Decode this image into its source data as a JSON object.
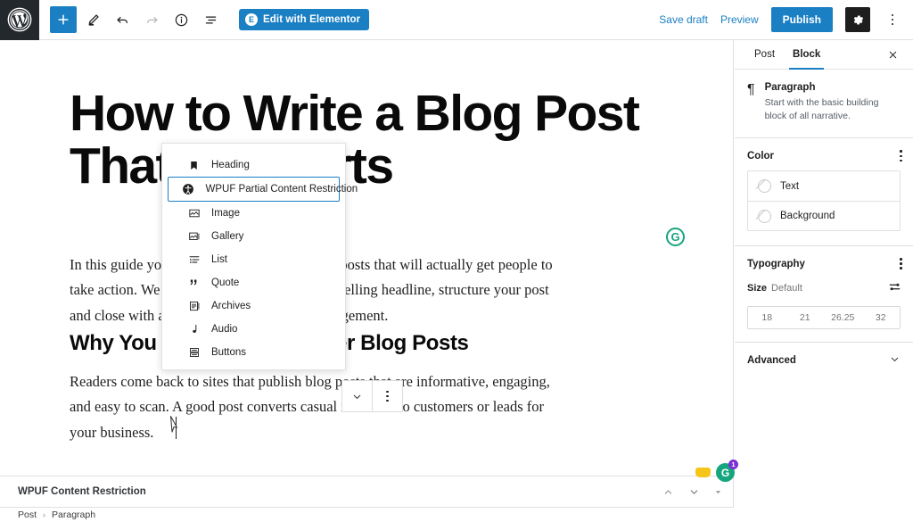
{
  "toolbar": {
    "logo_icon": "wordpress-logo-icon",
    "add_block_label": "+",
    "tools": [
      {
        "name": "add-block-button",
        "icon": "plus-icon"
      },
      {
        "name": "edit-tool-button",
        "icon": "pencil-icon"
      },
      {
        "name": "undo-button",
        "icon": "undo-icon"
      },
      {
        "name": "redo-button",
        "icon": "redo-icon"
      },
      {
        "name": "details-button",
        "icon": "info-icon"
      },
      {
        "name": "list-view-button",
        "icon": "list-view-icon"
      }
    ],
    "elementor_label": "Edit with Elementor",
    "elementor_badge": "E",
    "save_draft_label": "Save draft",
    "preview_label": "Preview",
    "publish_label": "Publish",
    "settings_icon": "gear-icon",
    "options_icon": "kebab-menu-icon",
    "accent_color": "#1b7fc4"
  },
  "editor": {
    "post_title": "How to Write a Blog Post That Converts",
    "paragraph_1": "In this guide you will learn how to write blog posts that will actually get people to take action. We will cover how to craft a compelling headline, structure your post and close with a call to action that drives engagement.",
    "heading_2": "Why You Should Write Better Blog Posts",
    "paragraph_2": "Readers come back to sites that publish blog posts that are informative, engaging, and easy to scan. A good post converts casual readers into customers or leads for your business.",
    "grammarly_icon": "grammarly-icon",
    "grammarly_letter": "G"
  },
  "inserter": {
    "items": [
      {
        "label": "Heading",
        "icon": "heading-icon",
        "selected": false
      },
      {
        "label": "WPUF Partial Content Restriction",
        "icon": "accessibility-icon",
        "selected": true
      },
      {
        "label": "Image",
        "icon": "image-icon",
        "selected": false
      },
      {
        "label": "Gallery",
        "icon": "gallery-icon",
        "selected": false
      },
      {
        "label": "List",
        "icon": "list-icon",
        "selected": false
      },
      {
        "label": "Quote",
        "icon": "quote-icon",
        "selected": false
      },
      {
        "label": "Archives",
        "icon": "archives-icon",
        "selected": false
      },
      {
        "label": "Audio",
        "icon": "audio-icon",
        "selected": false
      },
      {
        "label": "Buttons",
        "icon": "buttons-icon",
        "selected": false
      }
    ],
    "highlight_color": "#1b7fc4"
  },
  "sidebar": {
    "tabs": [
      {
        "label": "Post",
        "active": false
      },
      {
        "label": "Block",
        "active": true
      }
    ],
    "close_icon": "close-icon",
    "block": {
      "icon": "paragraph-icon",
      "glyph": "¶",
      "title": "Paragraph",
      "description": "Start with the basic building block of all narrative."
    },
    "color": {
      "title": "Color",
      "options_icon": "kebab-menu-icon",
      "rows": [
        {
          "label": "Text",
          "swatch": "none"
        },
        {
          "label": "Background",
          "swatch": "none"
        }
      ]
    },
    "typography": {
      "title": "Typography",
      "options_icon": "kebab-menu-icon",
      "size_label": "Size",
      "size_value": "Default",
      "adjust_icon": "sliders-icon",
      "sizes": [
        "18",
        "21",
        "26.25",
        "32"
      ]
    },
    "advanced": {
      "title": "Advanced",
      "chevron_icon": "chevron-down-icon"
    }
  },
  "bottom_panel": {
    "title": "WPUF Content Restriction",
    "actions": [
      {
        "name": "move-up-button",
        "icon": "chevron-up-icon"
      },
      {
        "name": "move-down-button",
        "icon": "chevron-down-icon"
      },
      {
        "name": "toggle-panel-button",
        "icon": "caret-down-icon"
      }
    ]
  },
  "breadcrumb": {
    "items": [
      "Post",
      "Paragraph"
    ],
    "separator": "›"
  },
  "float_widgets": {
    "note_icon": "sticky-note-icon",
    "assistant_icon": "grammarly-icon",
    "assistant_letter": "G",
    "badge_count": "1",
    "badge_color": "#7b2fd4",
    "assistant_color": "#15a67f"
  }
}
